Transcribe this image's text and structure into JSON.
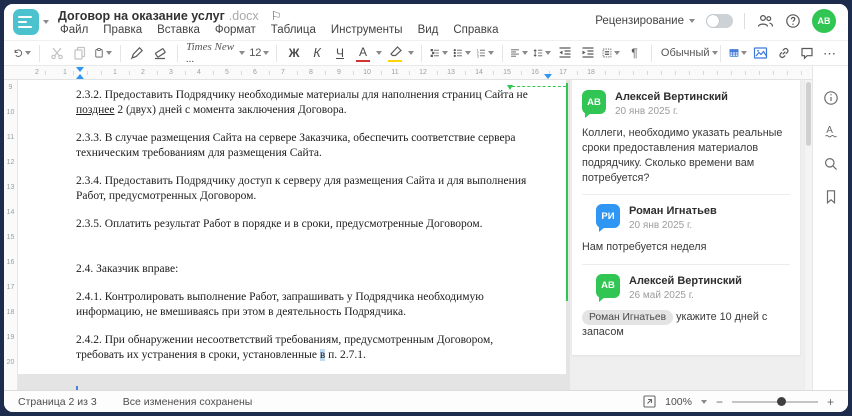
{
  "colors": {
    "accent_green": "#31c553",
    "accent_blue": "#2f96f3",
    "logo_teal": "#4bc2ce",
    "icon_blue": "#3e79d9",
    "highlight_yellow": "#fed500",
    "font_color_red": "#d43230",
    "comment_line": "#31c553"
  },
  "window": {
    "title": "Договор на оказание услуг",
    "title_ext": ".docx"
  },
  "icons": {
    "flag": "⚐",
    "pilcrow": "¶",
    "ellipsis": "⋯",
    "minus": "−",
    "plus": "+"
  },
  "menu": {
    "items": [
      "Файл",
      "Правка",
      "Вставка",
      "Формат",
      "Таблица",
      "Инструменты",
      "Вид",
      "Справка"
    ]
  },
  "header_right": {
    "review_label": "Рецензирование",
    "toggle_on": false,
    "avatar_initials": "АВ"
  },
  "toolbar": {
    "font_name": "Times New ...",
    "font_size": "12",
    "bold_label": "Ж",
    "italic_label": "К",
    "underline_label": "Ч",
    "font_color_label": "А",
    "style_name": "Обычный"
  },
  "ruler": {
    "pre_numbers": [
      "2",
      "1"
    ],
    "numbers": [
      "1",
      "2",
      "3",
      "4",
      "5",
      "6",
      "7",
      "8",
      "9",
      "10",
      "11",
      "12",
      "13",
      "14",
      "15",
      "16",
      "17",
      "18"
    ]
  },
  "vruler": {
    "numbers": [
      "9",
      "10",
      "11",
      "12",
      "13",
      "14",
      "15",
      "16",
      "17",
      "18",
      "19",
      "20"
    ]
  },
  "document": {
    "paragraphs": [
      {
        "runs": [
          {
            "t": "2.3.2. Предоставить Подрядчику необходимые материалы для наполнения страниц Сайта не "
          },
          {
            "t": "позднее",
            "u": true
          },
          {
            "t": " 2 (двух) дней с момента заключения Договора."
          }
        ]
      },
      {
        "runs": [
          {
            "t": "2.3.3. В случае размещения Сайта на сервере Заказчика, обеспечить соответствие сервера техническим требованиям для размещения Сайта."
          }
        ]
      },
      {
        "runs": [
          {
            "t": "2.3.4. Предоставить Подрядчику доступ к серверу для размещения Сайта и для выполнения Работ, предусмотренных Договором."
          }
        ]
      },
      {
        "runs": [
          {
            "t": "2.3.5. Оплатить результат Работ в порядке и в сроки, предусмотренные Договором."
          }
        ]
      },
      {
        "gap_before": true,
        "runs": [
          {
            "t": "2.4. Заказчик вправе:"
          }
        ]
      },
      {
        "runs": [
          {
            "t": "2.4.1. Контролировать выполнение Работ, запрашивать у Подрядчика необходимую информацию, не вмешиваясь при этом в деятельность Подрядчика."
          }
        ]
      },
      {
        "runs": [
          {
            "t": "2.4.2. При обнаружении несоответствий требованиям, предусмотренным Договором, требовать их устранения в сроки, установленные "
          },
          {
            "t": "в",
            "hl": true
          },
          {
            "t": " п. 2.7.1."
          }
        ]
      }
    ]
  },
  "comments": {
    "threads": [
      {
        "comments": [
          {
            "initials": "АВ",
            "color": "green",
            "name": "Алексей Вертинский",
            "date": "20 янв 2025 г.",
            "reply": false,
            "body": [
              {
                "t": "Коллеги, необходимо указать реальные сроки предоставления материалов подрядчику. Сколько времени вам потребуется?"
              }
            ]
          },
          {
            "initials": "РИ",
            "color": "blue",
            "name": "Роман Игнатьев",
            "date": "20 янв 2025 г.",
            "reply": true,
            "body": [
              {
                "t": "Нам потребуется неделя"
              }
            ]
          },
          {
            "initials": "АВ",
            "color": "green",
            "name": "Алексей Вертинский",
            "date": "26 май 2025 г.",
            "reply": true,
            "body": [
              {
                "mention": "Роман Игнатьев"
              },
              {
                "t": " укажите 10 дней с запасом"
              }
            ]
          }
        ]
      }
    ]
  },
  "status": {
    "page_label": "Страница 2 из 3",
    "saved_label": "Все изменения сохранены",
    "zoom_value": "100%"
  }
}
